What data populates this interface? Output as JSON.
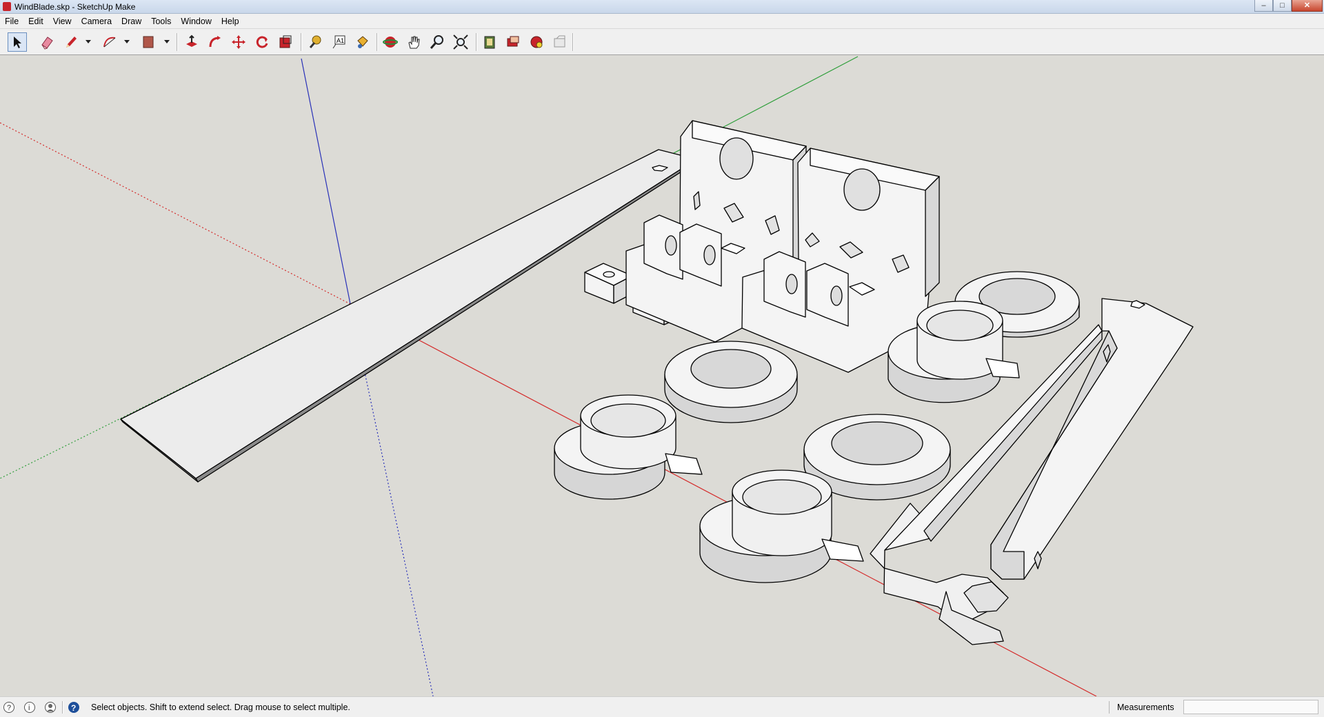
{
  "window": {
    "title": "WindBlade.skp - SketchUp Make",
    "controls": [
      "minimize",
      "maximize",
      "close"
    ]
  },
  "menu": [
    "File",
    "Edit",
    "View",
    "Camera",
    "Draw",
    "Tools",
    "Window",
    "Help"
  ],
  "toolbar": {
    "tools": [
      "select",
      "eraser",
      "pencil",
      "arc",
      "rectangle",
      "push-pull",
      "follow-me",
      "move",
      "rotate",
      "scale",
      "tape-measure",
      "text",
      "paint-bucket",
      "orbit",
      "pan",
      "zoom",
      "zoom-extents",
      "get-models",
      "share-model",
      "share-component",
      "extension-warehouse"
    ],
    "active_tool": "select"
  },
  "status": {
    "message": "Select objects. Shift to extend select. Drag mouse to select multiple.",
    "measurements_label": "Measurements",
    "measurements_value": ""
  },
  "colors": {
    "viewport_bg": "#dcdbd6",
    "axis_red": "#d42a2a",
    "axis_green": "#2e9e3a",
    "axis_blue": "#2830b8",
    "model_face": "#f4f4f4",
    "model_edge": "#000000"
  }
}
